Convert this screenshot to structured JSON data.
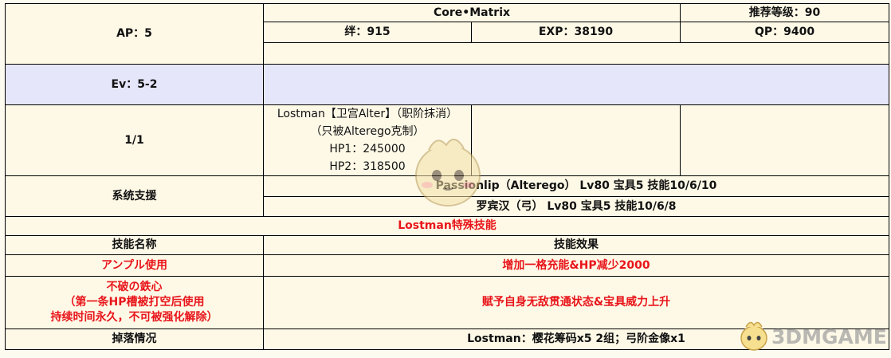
{
  "quest": {
    "title": "Core•Matrix",
    "recommended_level": "推荐等级：90",
    "ap": "AP：5",
    "bond": "绊：915",
    "exp": "EXP：38190",
    "qp": "QP：9400",
    "ev": "Ev：5-2"
  },
  "battle": {
    "wave": "1/1",
    "boss_lines": [
      "Lostman【卫宫Alter】（职阶抹消）",
      "（只被Alterego克制）",
      "HP1：245000",
      "HP2：318500"
    ]
  },
  "support": {
    "label": "系统支援",
    "entries": [
      "Passionlip（Alterego） Lv80 宝具5 技能10/6/10",
      "罗宾汉（弓） Lv80 宝具5 技能10/6/8"
    ]
  },
  "skills": {
    "section_title": "Lostman特殊技能",
    "col_name": "技能名称",
    "col_effect": "技能效果",
    "rows": [
      {
        "name_lines": [
          "アンプル使用"
        ],
        "effect": "增加一格充能&HP减少2000"
      },
      {
        "name_lines": [
          "不破の鉄心",
          "（第一条HP槽被打空后使用",
          "持续时间永久，不可被强化解除）"
        ],
        "effect": "赋予自身无敌贯通状态&宝具威力上升"
      }
    ]
  },
  "drops": {
    "label": "掉落情况",
    "value": "Lostman：樱花筹码x5 2组；弓阶金像x1"
  },
  "watermark": {
    "text": "3DMGAME"
  },
  "colors": {
    "background": "#fef9e7",
    "ev_row": "#e6e6fb",
    "highlight_red": "#e8151b",
    "border": "#000000"
  }
}
